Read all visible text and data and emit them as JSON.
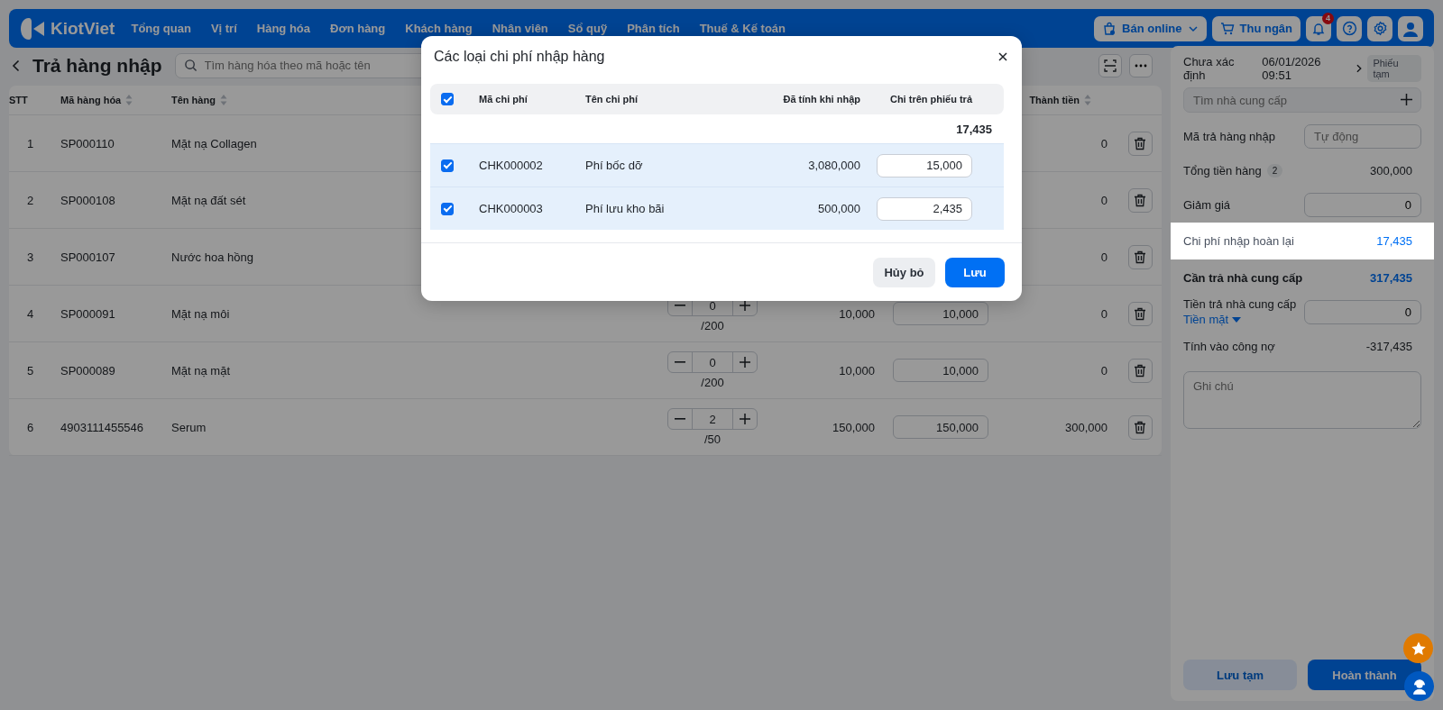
{
  "nav": {
    "logo": "KiotViet",
    "items": [
      "Tổng quan",
      "Vị trí",
      "Hàng hóa",
      "Đơn hàng",
      "Khách hàng",
      "Nhân viên",
      "Sổ quỹ",
      "Phân tích",
      "Thuế & Kế toán"
    ],
    "online_button": "Bán online",
    "cashier_button": "Thu ngân",
    "notification_count": "4"
  },
  "page": {
    "title": "Trả hàng nhập",
    "search": {
      "placeholder": "Tìm hàng hóa theo mã hoặc tên"
    }
  },
  "table": {
    "columns": [
      {
        "label": "STT",
        "sortable": false
      },
      {
        "label": "Mã hàng hóa",
        "sortable": true
      },
      {
        "label": "Tên hàng",
        "sortable": true
      },
      {
        "label": "Thành tiền",
        "sortable": true
      }
    ],
    "rows": [
      {
        "stt": "1",
        "code": "SP000110",
        "name": "Mặt nạ Collagen",
        "total": "0"
      },
      {
        "stt": "2",
        "code": "SP000108",
        "name": "Mặt nạ đất sét",
        "total": "0"
      },
      {
        "stt": "3",
        "code": "SP000107",
        "name": "Nước hoa hồng",
        "total": "0"
      },
      {
        "stt": "4",
        "code": "SP000091",
        "name": "Mặt nạ môi",
        "quantity": "0",
        "stock": "/200",
        "price": "10,000",
        "return_price": "10,000",
        "total": "0"
      },
      {
        "stt": "5",
        "code": "SP000089",
        "name": "Mặt nạ mặt",
        "quantity": "0",
        "stock": "/200",
        "price": "10,000",
        "return_price": "10,000",
        "total": "0"
      },
      {
        "stt": "6",
        "code": "4903111455546",
        "name": "Serum",
        "quantity": "2",
        "stock": "/50",
        "price": "150,000",
        "return_price": "150,000",
        "total": "300,000"
      }
    ]
  },
  "panel": {
    "supplier_status": "Chưa xác định",
    "datetime": "06/01/2026 09:51",
    "draft_badge": "Phiếu tạm",
    "supplier_search": {
      "placeholder": "Tìm nhà cung cấp"
    },
    "rows": [
      {
        "kind": "input",
        "label": "Mã trả hàng nhập",
        "placeholder": "Tự động",
        "highlighted": false
      },
      {
        "kind": "value",
        "label": "Tổng tiền hàng",
        "count": "2",
        "value": "300,000",
        "highlighted": false
      },
      {
        "kind": "input",
        "label": "Giảm giá",
        "value": "0",
        "highlighted": false
      },
      {
        "kind": "amount",
        "label": "Chi phí nhập hoàn lại",
        "value": "17,435",
        "highlighted": true
      },
      {
        "kind": "total",
        "label": "Cần trả nhà cung cấp",
        "value": "317,435",
        "highlighted": false
      },
      {
        "kind": "input",
        "label": "Tiền trả nhà cung cấp",
        "method": "Tiền mặt",
        "value": "0",
        "highlighted": false
      },
      {
        "kind": "value",
        "label": "Tính vào công nợ",
        "value": "-317,435",
        "highlighted": false
      }
    ],
    "note": {
      "placeholder": "Ghi chú"
    },
    "save_draft_button": "Lưu tạm",
    "complete_button": "Hoàn thành"
  },
  "modal": {
    "title": "Các loại chi phí nhập hàng",
    "all_checked": true,
    "columns": [
      "Mã chi phí",
      "Tên chi phí",
      "Đã tính khi nhập",
      "Chi trên phiếu trả"
    ],
    "total": "17,435",
    "rows": [
      {
        "checked": true,
        "code": "CHK000002",
        "name": "Phí bốc dỡ",
        "imported": "3,080,000",
        "amount": "15,000"
      },
      {
        "checked": true,
        "code": "CHK000003",
        "name": "Phí lưu kho bãi",
        "imported": "500,000",
        "amount": "2,435"
      }
    ],
    "cancel_button": "Hủy bỏ",
    "save_button": "Lưu"
  }
}
